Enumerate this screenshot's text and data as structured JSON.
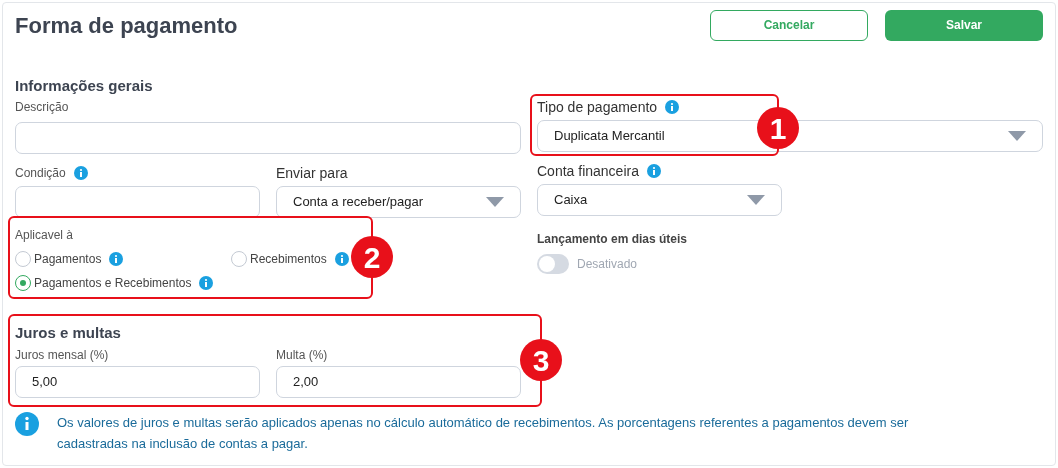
{
  "header": {
    "title": "Forma de pagamento",
    "buttons": [
      {
        "label": "Cancelar",
        "kind": "secondary"
      },
      {
        "label": "Salvar",
        "kind": "primary"
      }
    ]
  },
  "general": {
    "title": "Informações gerais",
    "description": {
      "label": "Descrição",
      "info": false
    },
    "condition": {
      "label": "Condição",
      "info": true
    },
    "send_to": {
      "label": "Enviar para",
      "info": false,
      "value": "Conta a receber/pagar"
    },
    "payment_type": {
      "label": "Tipo de pagamento",
      "info": true,
      "value": "Duplicata Mercantil"
    },
    "account": {
      "label": "Conta financeira",
      "info": true,
      "value": "Caixa"
    },
    "applies_to": {
      "label": "Aplicavel à",
      "options": [
        {
          "label": "Pagamentos",
          "info": true,
          "selected": false
        },
        {
          "label": "Recebimentos",
          "info": true,
          "selected": false
        },
        {
          "label": "Pagamentos e Recebimentos",
          "info": true,
          "selected": true
        }
      ]
    },
    "business_days": {
      "label": "Lançamento em dias úteis",
      "on": false,
      "status": "Desativado"
    }
  },
  "interest": {
    "title": "Juros e multas",
    "fields": [
      {
        "label": "Juros mensal (%)",
        "value": "5,00"
      },
      {
        "label": "Multa (%)",
        "value": "2,00"
      }
    ],
    "note": "Os valores de juros e multas serão aplicados apenas no cálculo automático de recebimentos. As porcentagens referentes a pagamentos devem ser cadastradas na inclusão de contas a pagar."
  },
  "annotations": [
    {
      "number": "1"
    },
    {
      "number": "2"
    },
    {
      "number": "3"
    }
  ]
}
